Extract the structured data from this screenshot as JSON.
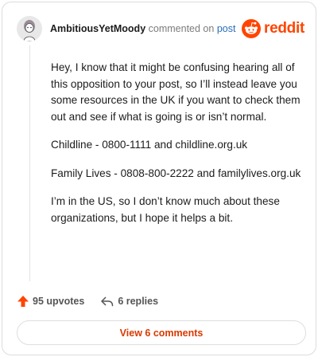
{
  "comment": {
    "username": "AmbitiousYetMoody",
    "action_text": "commented on",
    "target_link": "post",
    "paragraphs": [
      "Hey, I know that it might be confusing hearing all of this opposition to your post, so I’ll instead leave you some resources in the UK if you want to check them out and see if what is going is or isn’t normal.",
      "Childline - 0800-1111 and childline.org.uk",
      "Family Lives - 0808-800-2222 and familylives.org.uk",
      "I’m in the US, so I don’t know much about these organizations, but I hope it helps a bit."
    ]
  },
  "brand": {
    "logo_text": "reddit",
    "icon": "reddit-alien-icon",
    "color": "#ff4500"
  },
  "actions": {
    "upvotes_label": "95 upvotes",
    "upvote_icon": "upvote-arrow-icon",
    "replies_label": "6 replies",
    "reply_icon": "reply-arrow-icon"
  },
  "footer": {
    "view_comments_label": "View 6 comments",
    "accent": "#d93900"
  }
}
